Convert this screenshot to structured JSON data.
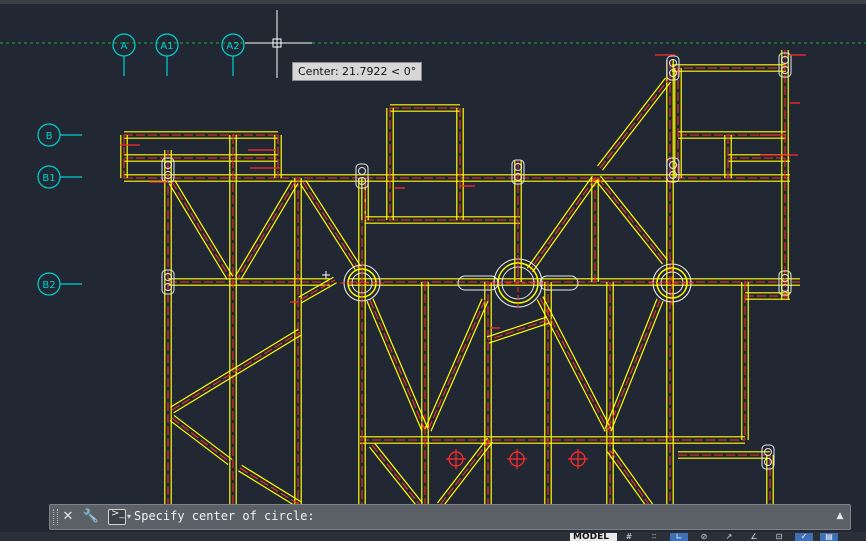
{
  "drawing": {
    "grid_bubbles_top": [
      "A",
      "A1",
      "A2"
    ],
    "grid_bubbles_left": [
      "B",
      "B1",
      "B2"
    ],
    "colors": {
      "background": "#212833",
      "steel_outline": "#ffff00",
      "steel_center": "#ff2a2a",
      "grid": "#00d2d2",
      "guide_line": "#1faa3a",
      "cursor": "#ffffff"
    }
  },
  "tooltip": {
    "text": "Center: 21.7922 < 0°"
  },
  "command_line": {
    "close_icon": "close-icon",
    "customize_icon": "wrench-icon",
    "prompt_icon": "command-prompt-icon",
    "prompt_text": "Specify center of circle:",
    "history_icon": "chevron-up-icon"
  },
  "status_bar": {
    "model_tab": "MODEL",
    "buttons": [
      {
        "icon": "grid-display-icon",
        "glyph": "#",
        "active": false
      },
      {
        "icon": "snap-mode-icon",
        "glyph": "∶∶",
        "active": false
      },
      {
        "icon": "ortho-mode-icon",
        "glyph": "∟",
        "active": true
      },
      {
        "icon": "polar-tracking-icon",
        "glyph": "⊘",
        "active": false
      },
      {
        "icon": "isodraft-icon",
        "glyph": "↗",
        "active": false
      },
      {
        "icon": "object-snap-tracking-icon",
        "glyph": "∠",
        "active": false
      },
      {
        "icon": "object-snap-icon",
        "glyph": "⊡",
        "active": false
      },
      {
        "icon": "lineweight-icon",
        "glyph": "✓",
        "active": true
      },
      {
        "icon": "transparency-icon",
        "glyph": "▤",
        "active": true
      }
    ]
  }
}
